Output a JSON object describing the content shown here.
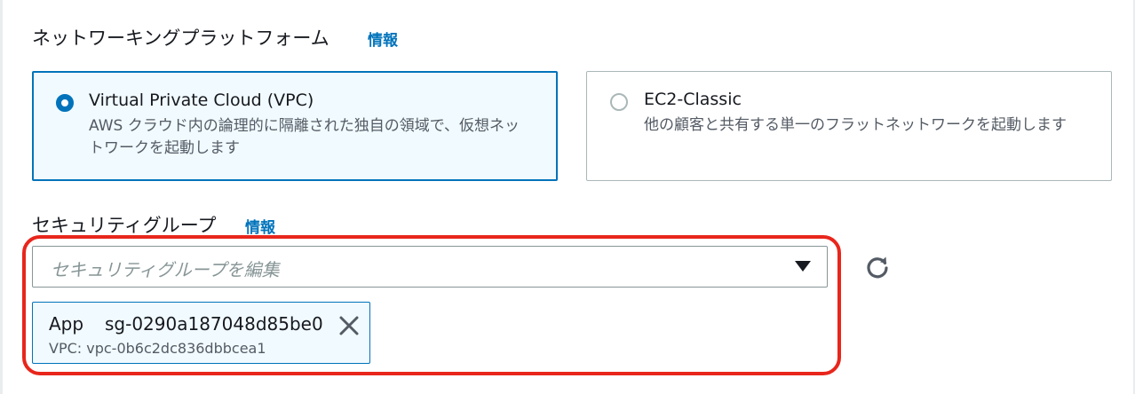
{
  "network_platform": {
    "label": "ネットワーキングプラットフォーム",
    "info": "情報",
    "options": [
      {
        "title": "Virtual Private Cloud (VPC)",
        "description": "AWS クラウド内の論理的に隔離された独自の領域で、仮想ネットワークを起動します",
        "selected": true
      },
      {
        "title": "EC2-Classic",
        "description": "他の顧客と共有する単一のフラットネットワークを起動します",
        "selected": false
      }
    ]
  },
  "security_group": {
    "label": "セキュリティグループ",
    "info": "情報",
    "placeholder": "セキュリティグループを編集",
    "dropdown_icon": "caret-down-icon",
    "refresh_icon": "refresh-icon",
    "selected_token": {
      "name": "App",
      "group_id": "sg-0290a187048d85be0",
      "vpc": "VPC: vpc-0b6c2dc836dbbcea1",
      "remove_icon": "close-icon"
    }
  },
  "colors": {
    "accent": "#0073bb",
    "highlight": "#e8261c",
    "selected_bg": "#f1faff",
    "text": "#16191f",
    "secondary_text": "#545b64",
    "placeholder": "#879596"
  }
}
